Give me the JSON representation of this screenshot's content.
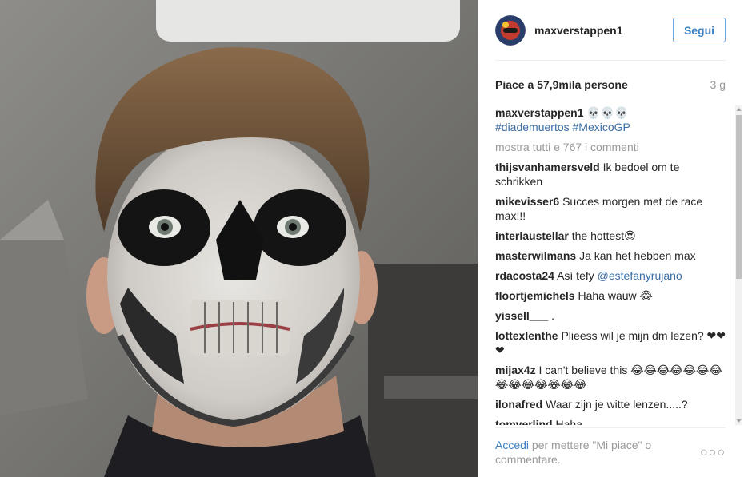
{
  "post": {
    "username": "maxverstappen1",
    "follow_label": "Segui",
    "likes": "Piace a 57,9mila persone",
    "time": "3 g"
  },
  "caption": {
    "user": "maxverstappen1",
    "emoji": "💀💀💀",
    "hashtags": "#diademuertos #MexicoGP"
  },
  "load_more": "mostra tutti e 767 i commenti",
  "comments": [
    {
      "user": "thijsvanhamersveld",
      "text": "Ik bedoel om te schrikken"
    },
    {
      "user": "mikevisser6",
      "text": "Succes morgen met de race max!!!"
    },
    {
      "user": "interlaustellar",
      "text": "the hottest😍"
    },
    {
      "user": "masterwilmans",
      "text": "Ja kan het hebben max"
    },
    {
      "user": "rdacosta24",
      "text": "Así tefy",
      "mention": "@estefanyrujano"
    },
    {
      "user": "floortjemichels",
      "text": "Haha wauw 😂"
    },
    {
      "user": "yissell___",
      "text": "."
    },
    {
      "user": "lottexlenthe",
      "text": "Plieess wil je mijn dm lezen? ❤❤❤"
    },
    {
      "user": "mijax4z",
      "text": "I can't believe this 😂😂😂😂😂😂😂😂😂😂😂😂😂😂"
    },
    {
      "user": "ilonafred",
      "text": "Waar zijn je witte lenzen.....?"
    },
    {
      "user": "tomverlind",
      "text": "Haha"
    }
  ],
  "footer": {
    "login_link": "Accedi",
    "login_text": "per mettere \"Mi piace\" o commentare.",
    "more_icon": "more-options-icon"
  },
  "colors": {
    "link": "#3a6ea5",
    "button_border": "#70a7dc",
    "muted": "#999999"
  }
}
